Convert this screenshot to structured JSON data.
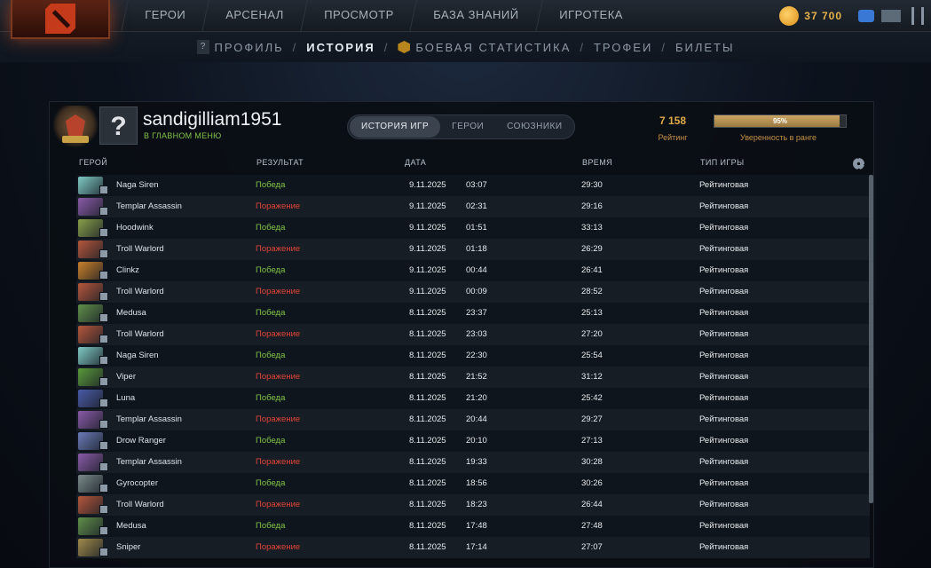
{
  "topbar": {
    "nav": [
      "ГЕРОИ",
      "АРСЕНАЛ",
      "ПРОСМОТР",
      "БАЗА ЗНАНИЙ",
      "ИГРОТЕКА"
    ],
    "shards": "37 700"
  },
  "subnav": {
    "items": [
      "ПРОФИЛЬ",
      "ИСТОРИЯ",
      "БОЕВАЯ СТАТИСТИКА",
      "ТРОФЕИ",
      "БИЛЕТЫ"
    ],
    "separator": "/",
    "active": "ИСТОРИЯ"
  },
  "profile": {
    "avatar_symbol": "?",
    "username": "sandigilliam1951",
    "status": "В ГЛАВНОМ МЕНЮ",
    "tabs": [
      "ИСТОРИЯ ИГР",
      "ГЕРОИ",
      "СОЮЗНИКИ"
    ],
    "rating_value": "7 158",
    "rating_label": "Рейтинг",
    "confidence_pct": "95%",
    "confidence_fraction": 0.95,
    "confidence_label": "Уверенность в ранге"
  },
  "table": {
    "headers": {
      "hero": "ГЕРОЙ",
      "result": "РЕЗУЛЬТАТ",
      "date": "ДАТА",
      "duration": "ВРЕМЯ",
      "type": "ТИП ИГРЫ"
    },
    "rows": [
      {
        "hero": "Naga Siren",
        "result": "Победа",
        "win": true,
        "date": "9.11.2025",
        "time": "03:07",
        "duration": "29:30",
        "type": "Рейтинговая",
        "color": "#7fc9c4"
      },
      {
        "hero": "Templar Assassin",
        "result": "Поражение",
        "win": false,
        "date": "9.11.2025",
        "time": "02:31",
        "duration": "29:16",
        "type": "Рейтинговая",
        "color": "#8a5aa8"
      },
      {
        "hero": "Hoodwink",
        "result": "Победа",
        "win": true,
        "date": "9.11.2025",
        "time": "01:51",
        "duration": "33:13",
        "type": "Рейтинговая",
        "color": "#8aa04a"
      },
      {
        "hero": "Troll Warlord",
        "result": "Поражение",
        "win": false,
        "date": "9.11.2025",
        "time": "01:18",
        "duration": "26:29",
        "type": "Рейтинговая",
        "color": "#b5563a"
      },
      {
        "hero": "Clinkz",
        "result": "Победа",
        "win": true,
        "date": "9.11.2025",
        "time": "00:44",
        "duration": "26:41",
        "type": "Рейтинговая",
        "color": "#c9802a"
      },
      {
        "hero": "Troll Warlord",
        "result": "Поражение",
        "win": false,
        "date": "9.11.2025",
        "time": "00:09",
        "duration": "28:52",
        "type": "Рейтинговая",
        "color": "#b5563a"
      },
      {
        "hero": "Medusa",
        "result": "Победа",
        "win": true,
        "date": "8.11.2025",
        "time": "23:37",
        "duration": "25:13",
        "type": "Рейтинговая",
        "color": "#5f8f4a"
      },
      {
        "hero": "Troll Warlord",
        "result": "Поражение",
        "win": false,
        "date": "8.11.2025",
        "time": "23:03",
        "duration": "27:20",
        "type": "Рейтинговая",
        "color": "#b5563a"
      },
      {
        "hero": "Naga Siren",
        "result": "Победа",
        "win": true,
        "date": "8.11.2025",
        "time": "22:30",
        "duration": "25:54",
        "type": "Рейтинговая",
        "color": "#7fc9c4"
      },
      {
        "hero": "Viper",
        "result": "Поражение",
        "win": false,
        "date": "8.11.2025",
        "time": "21:52",
        "duration": "31:12",
        "type": "Рейтинговая",
        "color": "#5a9a3a"
      },
      {
        "hero": "Luna",
        "result": "Победа",
        "win": true,
        "date": "8.11.2025",
        "time": "21:20",
        "duration": "25:42",
        "type": "Рейтинговая",
        "color": "#4a5aa8"
      },
      {
        "hero": "Templar Assassin",
        "result": "Поражение",
        "win": false,
        "date": "8.11.2025",
        "time": "20:44",
        "duration": "29:27",
        "type": "Рейтинговая",
        "color": "#8a5aa8"
      },
      {
        "hero": "Drow Ranger",
        "result": "Победа",
        "win": true,
        "date": "8.11.2025",
        "time": "20:10",
        "duration": "27:13",
        "type": "Рейтинговая",
        "color": "#6a7ab8"
      },
      {
        "hero": "Templar Assassin",
        "result": "Поражение",
        "win": false,
        "date": "8.11.2025",
        "time": "19:33",
        "duration": "30:28",
        "type": "Рейтинговая",
        "color": "#8a5aa8"
      },
      {
        "hero": "Gyrocopter",
        "result": "Победа",
        "win": true,
        "date": "8.11.2025",
        "time": "18:56",
        "duration": "30:26",
        "type": "Рейтинговая",
        "color": "#7a8a8a"
      },
      {
        "hero": "Troll Warlord",
        "result": "Поражение",
        "win": false,
        "date": "8.11.2025",
        "time": "18:23",
        "duration": "26:44",
        "type": "Рейтинговая",
        "color": "#b5563a"
      },
      {
        "hero": "Medusa",
        "result": "Победа",
        "win": true,
        "date": "8.11.2025",
        "time": "17:48",
        "duration": "27:48",
        "type": "Рейтинговая",
        "color": "#5f8f4a"
      },
      {
        "hero": "Sniper",
        "result": "Поражение",
        "win": false,
        "date": "8.11.2025",
        "time": "17:14",
        "duration": "27:07",
        "type": "Рейтинговая",
        "color": "#a08a4a"
      }
    ]
  }
}
